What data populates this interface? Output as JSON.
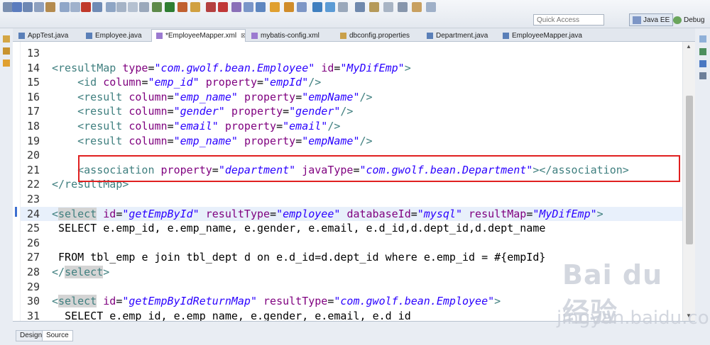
{
  "toolbar": {
    "quick_access_placeholder": "Quick Access",
    "perspectives": [
      {
        "label": "Java EE",
        "active": true
      },
      {
        "label": "Debug",
        "active": false
      }
    ]
  },
  "tabs": [
    {
      "label": "AppTest.java",
      "icon": "java-file-icon"
    },
    {
      "label": "Employee.java",
      "icon": "java-file-icon"
    },
    {
      "label": "*EmployeeMapper.xml",
      "icon": "xml-file-icon",
      "active": true,
      "closable": true,
      "close_glyph": "⊠"
    },
    {
      "label": "mybatis-config.xml",
      "icon": "xml-file-icon"
    },
    {
      "label": "dbconfig.properties",
      "icon": "properties-file-icon"
    },
    {
      "label": "Department.java",
      "icon": "java-file-icon"
    },
    {
      "label": "EmployeeMapper.java",
      "icon": "java-file-icon"
    }
  ],
  "editor": {
    "lines": [
      {
        "n": "13",
        "text": ""
      },
      {
        "n": "14",
        "text": "<resultMap type=\"com.gwolf.bean.Employee\" id=\"MyDifEmp\">"
      },
      {
        "n": "15",
        "text": "    <id column=\"emp_id\" property=\"empId\"/>"
      },
      {
        "n": "16",
        "text": "    <result column=\"emp_name\" property=\"empName\"/>"
      },
      {
        "n": "17",
        "text": "    <result column=\"gender\" property=\"gender\"/>"
      },
      {
        "n": "18",
        "text": "    <result column=\"email\" property=\"email\"/>"
      },
      {
        "n": "19",
        "text": "    <result column=\"emp_name\" property=\"empName\"/>"
      },
      {
        "n": "20",
        "text": ""
      },
      {
        "n": "21",
        "text": "    <association property=\"department\" javaType=\"com.gwolf.bean.Department\"></association>"
      },
      {
        "n": "22",
        "text": "</resultMap>"
      },
      {
        "n": "23",
        "text": ""
      },
      {
        "n": "24",
        "text": "<select id=\"getEmpById\" resultType=\"employee\" databaseId=\"mysql\" resultMap=\"MyDifEmp\">"
      },
      {
        "n": "25",
        "text": " SELECT e.emp_id, e.emp_name, e.gender, e.email, e.d_id,d.dept_id,d.dept_name"
      },
      {
        "n": "26",
        "text": ""
      },
      {
        "n": "27",
        "text": " FROM tbl_emp e join tbl_dept d on e.d_id=d.dept_id where e.emp_id = #{empId}"
      },
      {
        "n": "28",
        "text": "</select>"
      },
      {
        "n": "29",
        "text": ""
      },
      {
        "n": "30",
        "text": "<select id=\"getEmpByIdReturnMap\" resultType=\"com.gwolf.bean.Employee\">"
      },
      {
        "n": "31",
        "text": "  SELECT e.emp_id, e.emp_name, e.gender, e.email, e.d_id"
      }
    ]
  },
  "bottom_tabs": [
    {
      "label": "Design",
      "active": false
    },
    {
      "label": "Source",
      "active": true
    }
  ],
  "watermark": {
    "logo_text": "Bai du 经验",
    "url_text": "jingyan.baidu.com"
  },
  "colors": {
    "xml_tag": "#3f7f7f",
    "xml_attribute": "#7f007f",
    "xml_value": "#2a00ff",
    "current_line": "#e8f0fb",
    "annotation_box": "#e02020"
  }
}
